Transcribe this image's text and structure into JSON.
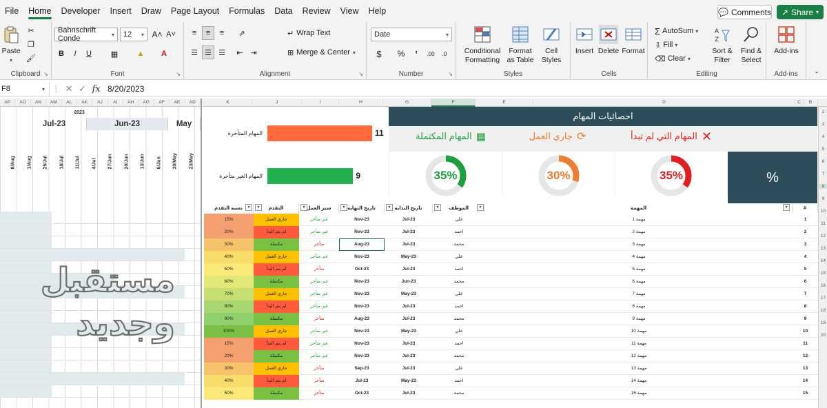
{
  "menu": {
    "tabs": [
      "File",
      "Home",
      "Developer",
      "Insert",
      "Draw",
      "Page Layout",
      "Formulas",
      "Data",
      "Review",
      "View",
      "Help"
    ],
    "active": "Home",
    "comments_label": "Comments",
    "share_label": "Share"
  },
  "ribbon": {
    "clipboard": {
      "label": "Clipboard",
      "paste": "Paste"
    },
    "font": {
      "label": "Font",
      "font_name": "Bahnschrift Conde",
      "font_size": "12"
    },
    "alignment": {
      "label": "Alignment",
      "wrap_text": "Wrap Text",
      "merge_center": "Merge & Center"
    },
    "number": {
      "label": "Number",
      "format": "Date"
    },
    "styles": {
      "label": "Styles",
      "conditional": "Conditional Formatting",
      "format_table": "Format as Table",
      "cell_styles": "Cell Styles"
    },
    "cells": {
      "label": "Cells",
      "insert": "Insert",
      "delete": "Delete",
      "format": "Format"
    },
    "editing": {
      "label": "Editing",
      "autosum": "AutoSum",
      "fill": "Fill",
      "clear": "Clear",
      "sort_filter": "Sort & Filter",
      "find_select": "Find & Select"
    },
    "addins": {
      "label": "Add-ins",
      "addins": "Add-ins"
    }
  },
  "formula_bar": {
    "name_box": "F8",
    "value": "8/20/2023"
  },
  "columns": {
    "gantt": [
      "AP",
      "AO",
      "AN",
      "AM",
      "AL",
      "AK",
      "AJ",
      "AI",
      "AH",
      "AG",
      "AF",
      "AE",
      "AD"
    ],
    "dashboard": [
      "K",
      "J",
      "I",
      "H",
      "G",
      "F",
      "E",
      "D",
      "C",
      "B"
    ]
  },
  "gantt": {
    "year": "2023",
    "months": [
      "Jul-23",
      "Jun-23",
      "May"
    ],
    "days": [
      "8/Aug",
      "1/Aug",
      "25/Jul",
      "18/Jul",
      "11/Jul",
      "4/Jul",
      "27/Jun",
      "20/Jun",
      "13/Jun",
      "6/Jun",
      "30/May",
      "23/May"
    ]
  },
  "chart": {
    "late_label": "المهام المتأخرة",
    "late_value": 11,
    "ontime_label": "المهام الغير متأخرة",
    "ontime_value": 9,
    "late_color": "#ff6b3d",
    "ontime_color": "#22b14c"
  },
  "stats": {
    "title": "احصائيات المهام",
    "not_started": {
      "label": "المهام التي لم تبدأ",
      "percent": "35%",
      "value": 35,
      "color": "#e02020"
    },
    "in_progress": {
      "label": "جاري العمل",
      "percent": "30%",
      "value": 30,
      "color": "#ed7d31"
    },
    "completed": {
      "label": "المهام المكتملة",
      "percent": "35%",
      "value": 35,
      "color": "#1e9e3c"
    },
    "percent_symbol": "%"
  },
  "table": {
    "headers": {
      "progress_pct": "نسبة التقدم",
      "progress": "التقدم",
      "workflow": "سير العمل",
      "end_date": "تاريخ النهاية",
      "start_date": "تاريخ البداية",
      "employee": "الموظف",
      "task": "المهمة",
      "num": "#"
    },
    "rows": [
      {
        "pct": "15%",
        "status": "جاري العمل",
        "flow": "غير متأخر",
        "end": "Nov-23",
        "start": "Jul-23",
        "emp": "علي",
        "task": "مهمة 1",
        "n": "1"
      },
      {
        "pct": "20%",
        "status": "لم يتم البدأ",
        "flow": "غير متأخر",
        "end": "Nov-23",
        "start": "Jul-23",
        "emp": "احمد",
        "task": "مهمة 2",
        "n": "2"
      },
      {
        "pct": "30%",
        "status": "مكتملة",
        "flow": "متأخر",
        "end": "Aug-23",
        "start": "Jul-23",
        "emp": "محمد",
        "task": "مهمة 3",
        "n": "3"
      },
      {
        "pct": "40%",
        "status": "جاري العمل",
        "flow": "غير متأخر",
        "end": "Nov-23",
        "start": "May-23",
        "emp": "علي",
        "task": "مهمة 4",
        "n": "4"
      },
      {
        "pct": "50%",
        "status": "لم يتم البدأ",
        "flow": "متأخر",
        "end": "Oct-23",
        "start": "Jul-23",
        "emp": "احمد",
        "task": "مهمة 5",
        "n": "5"
      },
      {
        "pct": "60%",
        "status": "مكتملة",
        "flow": "غير متأخر",
        "end": "Nov-23",
        "start": "Jun-23",
        "emp": "محمد",
        "task": "مهمة 6",
        "n": "6"
      },
      {
        "pct": "70%",
        "status": "جاري العمل",
        "flow": "غير متأخر",
        "end": "Nov-23",
        "start": "May-23",
        "emp": "علي",
        "task": "مهمة 7",
        "n": "7"
      },
      {
        "pct": "80%",
        "status": "لم يتم البدأ",
        "flow": "غير متأخر",
        "end": "Nov-23",
        "start": "Jul-23",
        "emp": "احمد",
        "task": "مهمة 8",
        "n": "8"
      },
      {
        "pct": "90%",
        "status": "مكتملة",
        "flow": "متأخر",
        "end": "Aug-23",
        "start": "Jul-23",
        "emp": "محمد",
        "task": "مهمة 9",
        "n": "9"
      },
      {
        "pct": "100%",
        "status": "جاري العمل",
        "flow": "غير متأخر",
        "end": "Nov-23",
        "start": "May-23",
        "emp": "علي",
        "task": "مهمة 10",
        "n": "10"
      },
      {
        "pct": "15%",
        "status": "لم يتم البدأ",
        "flow": "غير متأخر",
        "end": "Nov-23",
        "start": "Jul-23",
        "emp": "احمد",
        "task": "مهمة 11",
        "n": "11"
      },
      {
        "pct": "20%",
        "status": "مكتملة",
        "flow": "غير متأخر",
        "end": "Nov-23",
        "start": "Jul-23",
        "emp": "محمد",
        "task": "مهمة 12",
        "n": "12"
      },
      {
        "pct": "30%",
        "status": "جاري العمل",
        "flow": "متأخر",
        "end": "Sep-23",
        "start": "Jul-23",
        "emp": "علي",
        "task": "مهمة 13",
        "n": "13"
      },
      {
        "pct": "40%",
        "status": "لم يتم البدأ",
        "flow": "متأخر",
        "end": "Jul-23",
        "start": "May-23",
        "emp": "احمد",
        "task": "مهمة 14",
        "n": "14"
      },
      {
        "pct": "50%",
        "status": "مكتملة",
        "flow": "متأخر",
        "end": "Oct-23",
        "start": "Jul-23",
        "emp": "محمد",
        "task": "مهمة 15",
        "n": "15"
      }
    ],
    "row_numbers": [
      "2",
      "3",
      "4",
      "5",
      "6",
      "7",
      "8",
      "9",
      "10",
      "11",
      "12",
      "13",
      "14",
      "15",
      "16",
      "17",
      "18",
      "19",
      "20"
    ]
  },
  "watermark": {
    "line1": "مستقبل",
    "line2": "وجديد"
  },
  "colors": {
    "status_in_progress": "#ffc000",
    "status_not_started": "#ff5a3c",
    "status_completed": "#7ac143",
    "flow_ontime": "#1e9e3c",
    "flow_late": "#e02020",
    "header_dark": "#2e4d5a",
    "excel_green": "#107c41"
  }
}
